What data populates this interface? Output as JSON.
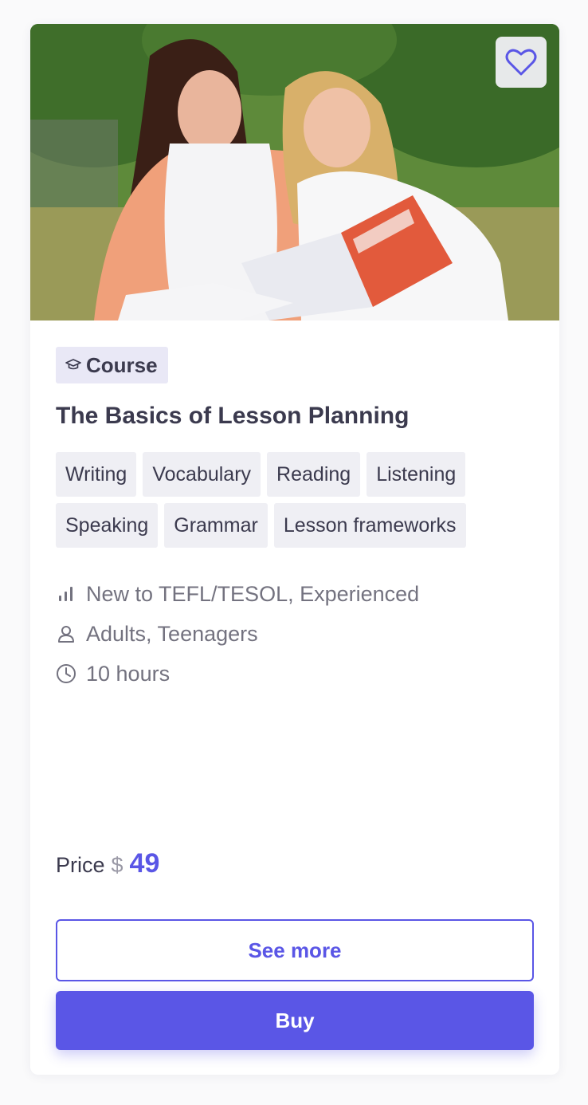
{
  "card": {
    "favorite_icon": "heart-icon",
    "type_badge": {
      "icon": "graduation-cap-icon",
      "label": "Course"
    },
    "title": "The Basics of Lesson Planning",
    "tags": [
      "Writing",
      "Vocabulary",
      "Reading",
      "Listening",
      "Speaking",
      "Grammar",
      "Lesson frameworks"
    ],
    "meta": {
      "level": {
        "icon": "level-bars-icon",
        "text": "New to TEFL/TESOL, Experienced"
      },
      "audience": {
        "icon": "user-icon",
        "text": "Adults, Teenagers"
      },
      "duration": {
        "icon": "clock-icon",
        "text": "10 hours"
      }
    },
    "price": {
      "label": "Price",
      "currency": "$",
      "value": "49"
    },
    "buttons": {
      "see_more": "See more",
      "buy": "Buy"
    }
  },
  "colors": {
    "accent": "#5a56e6",
    "text_dark": "#3b3a4e",
    "text_muted": "#73727f",
    "tag_bg": "#efeff4",
    "badge_bg": "#e9e8f6"
  }
}
